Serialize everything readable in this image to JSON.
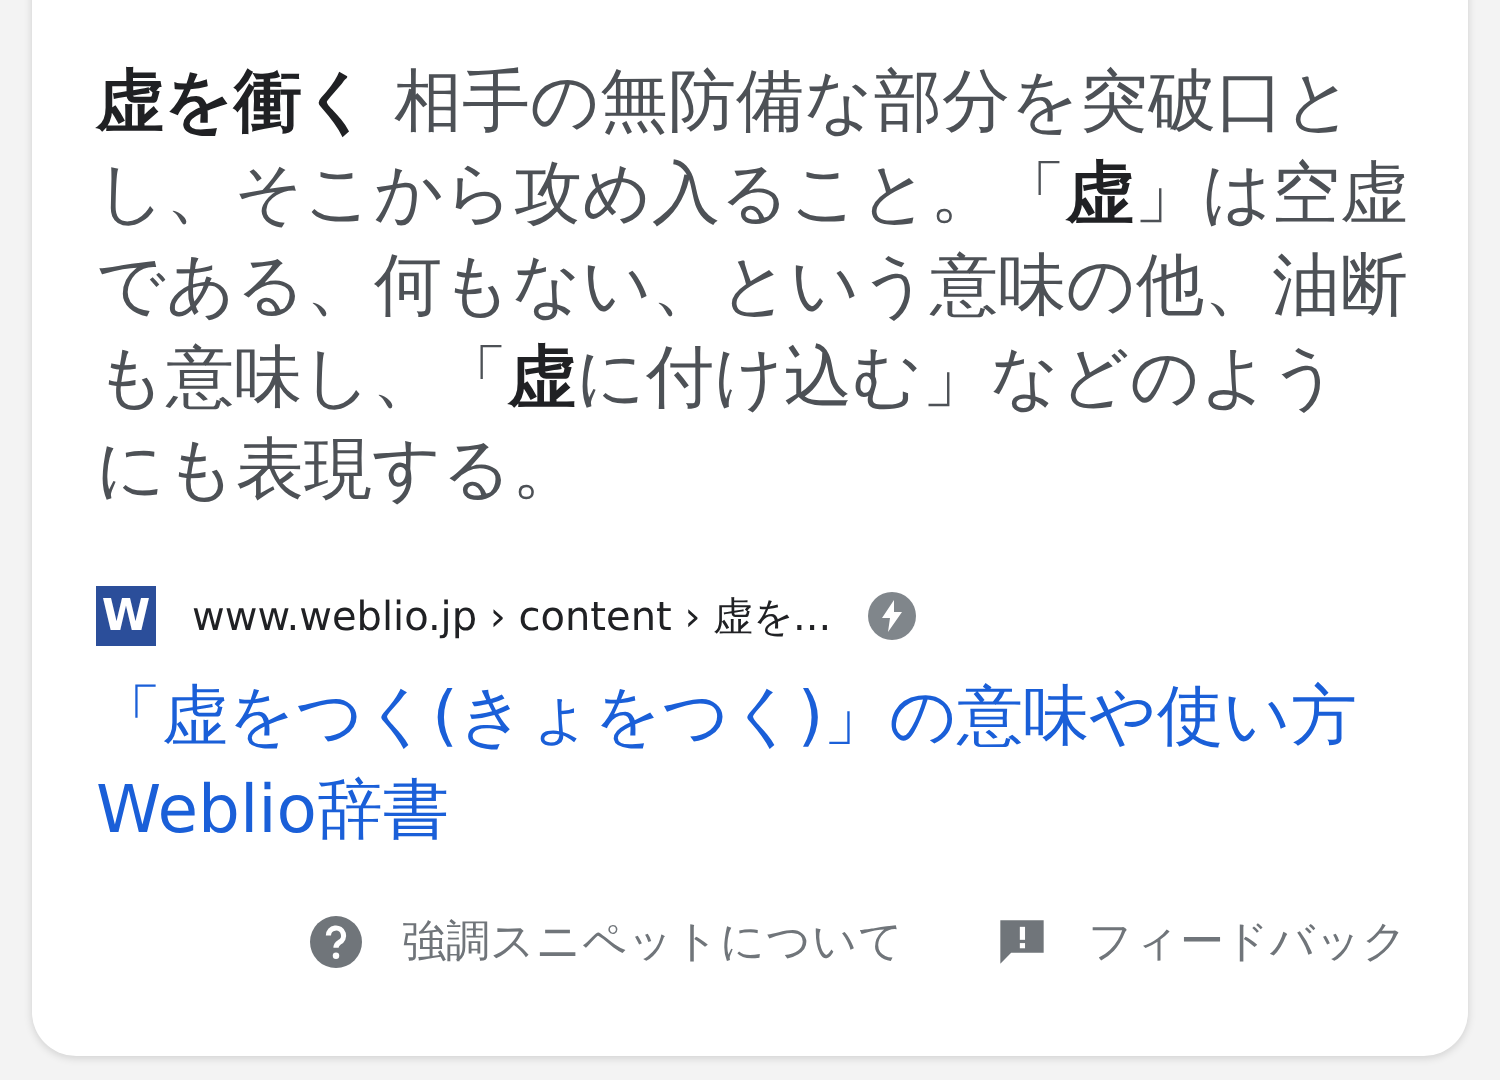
{
  "snippet": {
    "text": "**虚を衝く** 相手の無防備な部分を突破口とし、そこから攻め入ること。「**虚**」は空虚である、何もない、という意味の他、油断も意味し、「**虚**に付け込む」などのようにも表現する。"
  },
  "source": {
    "url": "www.weblio.jp › content › 虚を...",
    "amp": true,
    "favicon": "W"
  },
  "result_title": "「虚をつく(きょをつく)」の意味や使い方 Weblio辞書",
  "footer": [
    "強調スニペットについて",
    "フィードバック"
  ]
}
